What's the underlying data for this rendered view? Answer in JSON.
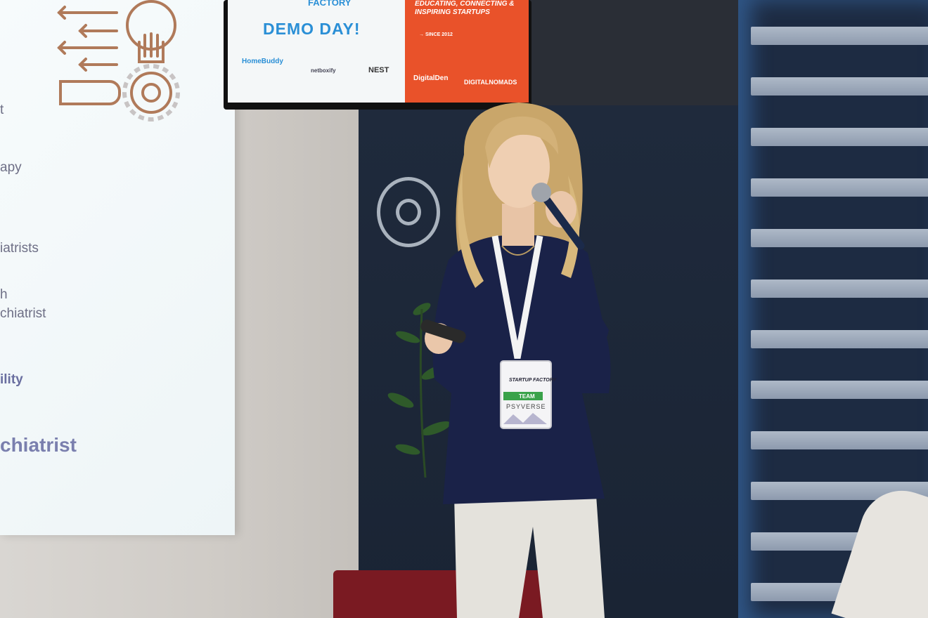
{
  "scene": {
    "description_colors": {
      "wall": "#d4d0cb",
      "pillar": "#1c2638",
      "blinds_light": "#5aa0e6",
      "tv_orange": "#e9522a",
      "sweater": "#1a2248",
      "pants": "#e8e6e1",
      "bench": "#7a1a22"
    }
  },
  "projection_slide": {
    "lines": [
      "t",
      "apy",
      "iatrists",
      "h",
      "chiatrist",
      "ility",
      "chiatrist"
    ]
  },
  "tv_screen": {
    "factory": "FACTORY",
    "headline": "DEMO DAY!",
    "tagline": "EDUCATING, CONNECTING & INSPIRING STARTUPS",
    "since": "→ SINCE 2012",
    "logos": [
      "HomeBuddy",
      "netboxify",
      "NEST",
      "DigitalDen",
      "DIGITALNOMADS"
    ]
  },
  "badge": {
    "brand": "STARTUP FACTORY",
    "team_label": "TEAM",
    "team_name": "PSYVERSE"
  }
}
